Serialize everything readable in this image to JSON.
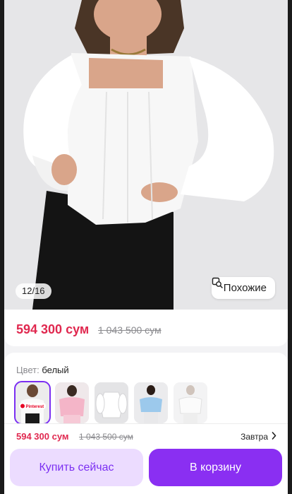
{
  "gallery": {
    "counter": "12/16",
    "similar_label": "Похожие"
  },
  "price": {
    "current": "594 300 сум",
    "old": "1 043 500 сум"
  },
  "color": {
    "label": "Цвет:",
    "value": "белый",
    "swatch_badge": "Pinterest"
  },
  "bottom_bar": {
    "price": "594 300 сум",
    "old_price": "1 043 500 сум",
    "delivery": "Завтра",
    "buy_now": "Купить сейчас",
    "add_to_cart": "В корзину"
  },
  "colors": {
    "accent": "#8a2ff2",
    "price": "#e0284f",
    "accent_light": "#ecdcff"
  }
}
